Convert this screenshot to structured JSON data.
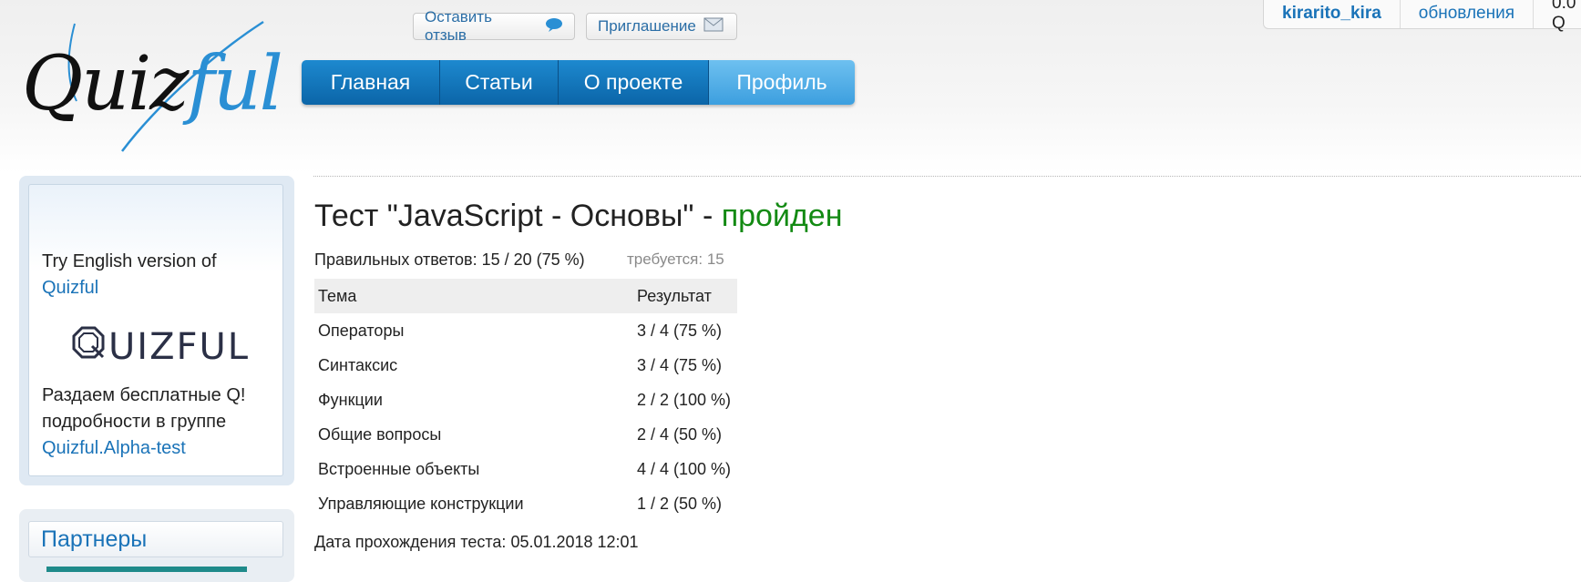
{
  "header": {
    "logo_main": "Quiz",
    "logo_accent": "ful",
    "feedback_button": "Оставить отзыв",
    "invite_button": "Приглашение"
  },
  "nav": {
    "items": [
      "Главная",
      "Статьи",
      "О проекте",
      "Профиль"
    ],
    "active": "Профиль"
  },
  "user_bar": {
    "username": "kirarito_kira",
    "updates": "обновления",
    "balance": "0.0 Q"
  },
  "sidebar": {
    "promo_line1": "Try English version of",
    "promo_link": "Quizful",
    "quizful_logo_text": "UIZFUL",
    "giveaway_line1": "Раздаем бесплатные Q!",
    "giveaway_line2": "подробности в группе",
    "giveaway_link": "Quizful.Alpha-test",
    "partners_title": "Партнеры"
  },
  "result": {
    "title_prefix": "Тест \"JavaScript - Основы\" - ",
    "status": "пройден",
    "correct_answers": "Правильных ответов: 15 / 20 (75 %)",
    "required": "требуется: 15",
    "table_headers": [
      "Тема",
      "Результат"
    ],
    "rows": [
      [
        "Операторы",
        "3 / 4 (75 %)"
      ],
      [
        "Синтаксис",
        "3 / 4 (75 %)"
      ],
      [
        "Функции",
        "2 / 2 (100 %)"
      ],
      [
        "Общие вопросы",
        "2 / 4 (50 %)"
      ],
      [
        "Встроенные объекты",
        "4 / 4 (100 %)"
      ],
      [
        "Управляющие конструкции",
        "1 / 2 (50 %)"
      ]
    ],
    "date": "Дата прохождения теста: 05.01.2018 12:01"
  },
  "colors": {
    "accent": "#1a73b8",
    "nav_blue": "#0b65a8",
    "nav_active": "#4aa7e3",
    "passed_green": "#138a13"
  },
  "icons": {
    "feedback": "speech-bubble-icon",
    "invite": "envelope-icon"
  }
}
